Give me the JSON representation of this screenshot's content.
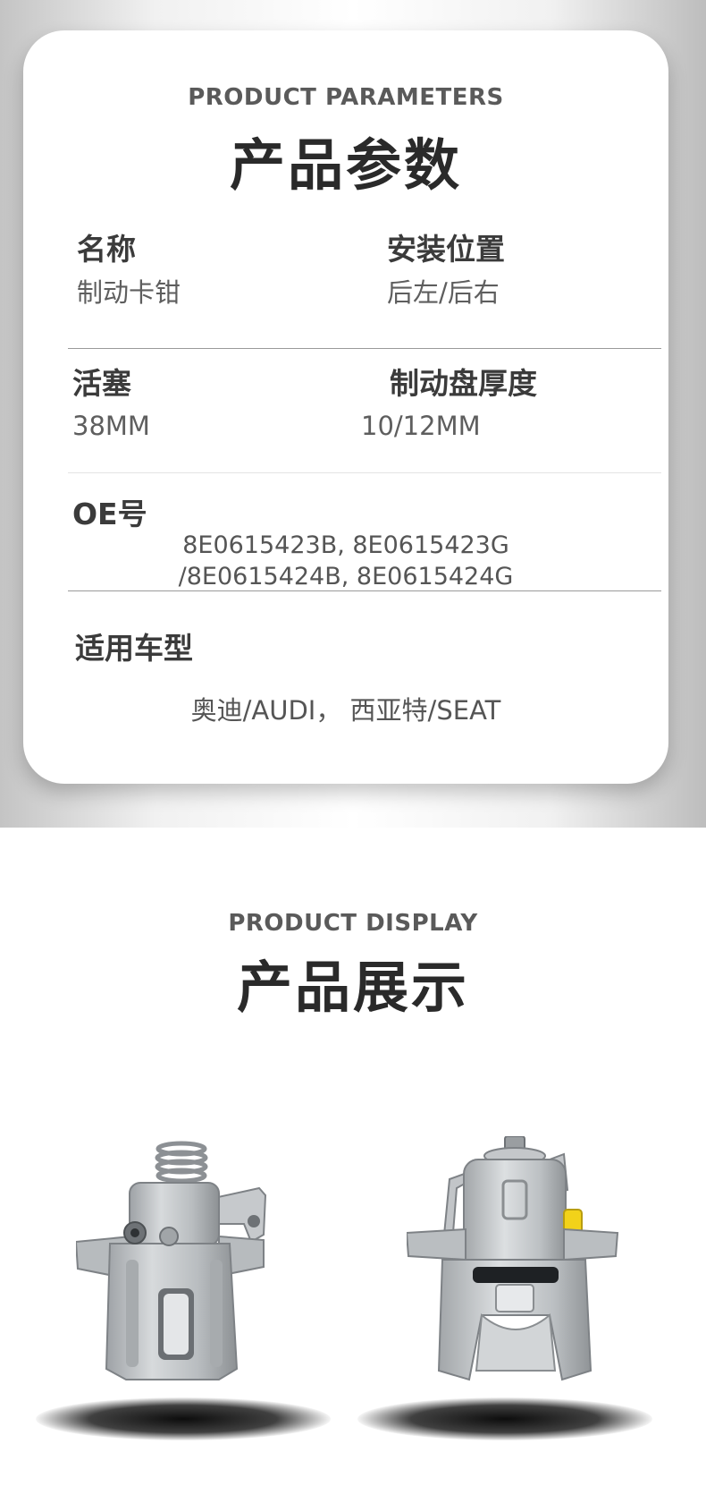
{
  "parameters": {
    "eyebrow": "PRODUCT PARAMETERS",
    "title": "产品参数",
    "name_label": "名称",
    "name_value": "制动卡钳",
    "position_label": "安装位置",
    "position_value": "后左/后右",
    "piston_label": "活塞",
    "piston_value": "38MM",
    "disc_label": "制动盘厚度",
    "disc_value": "10/12MM",
    "oe_label": "OE号",
    "oe_line1": "8E0615423B, 8E0615423G",
    "oe_line2": "/8E0615424B, 8E0615424G",
    "models_label": "适用车型",
    "models_value": "奥迪/AUDI，  西亚特/SEAT"
  },
  "display": {
    "eyebrow": "PRODUCT DISPLAY",
    "title": "产品展示",
    "images": [
      "brake-caliper-left-view",
      "brake-caliper-rear-view"
    ]
  },
  "colors": {
    "card_background": "#ffffff",
    "heading_text": "#2a2a2a",
    "body_text": "#5e5e5e",
    "caliper_metal": "#c9ccce",
    "bleed_cap": "#f2d21a"
  }
}
